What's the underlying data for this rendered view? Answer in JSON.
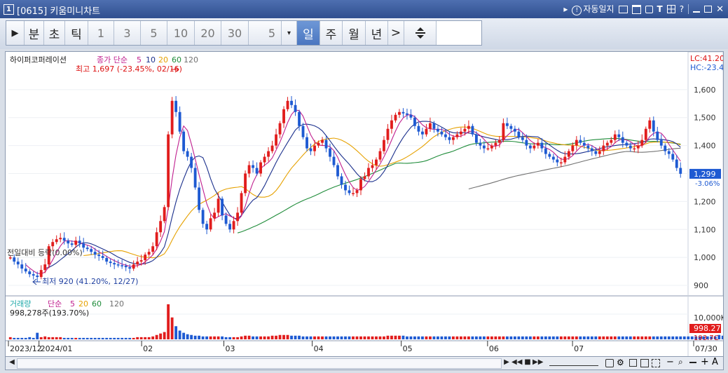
{
  "window": {
    "number_badge": "1",
    "title": "[0615] 키움미니차트",
    "title_right": {
      "arrow": "▸",
      "indicator_label": "자동일지",
      "icons": [
        "layout-icon",
        "window-icon",
        "pin-icon",
        "text-icon",
        "grid-icon",
        "help-icon"
      ],
      "help_label": "?",
      "text_label": "T"
    }
  },
  "toolbar": {
    "play_label": "▶",
    "period_units": [
      "분",
      "초",
      "틱"
    ],
    "intervals": [
      "1",
      "3",
      "5",
      "10",
      "20",
      "30"
    ],
    "custom_interval": "5",
    "dropdown_label": "▾",
    "periods": [
      "일",
      "주",
      "월",
      "년"
    ],
    "selected_period": "일",
    "next_label": ">",
    "tool_icon": "split-vertical-icon"
  },
  "price_panel": {
    "stock_name": "하이퍼코퍼레이션",
    "ma_label": "종가 단순",
    "ma_periods": [
      "5",
      "10",
      "20",
      "60",
      "120"
    ],
    "ma_colors": [
      "#c0208f",
      "#1a2f8c",
      "#e6a100",
      "#1f8c3a",
      "#707070"
    ],
    "max_annotation": "최고 1,697 (-23.45%, 02/16)",
    "min_annotation": "최저 920 (41.20%, 12/27)",
    "prev_close_annotation": "전일대비 등락(0.00%)",
    "lc_label": "LC:41.20",
    "hc_label": "HC:-23.4",
    "current_price": "1,299",
    "current_change": "-3.06%",
    "y_ticks": [
      "1,600",
      "1,500",
      "1,400",
      "1,300",
      "1,200",
      "1,100",
      "1,000",
      "900"
    ]
  },
  "volume_panel": {
    "label": "거래량",
    "ma_label": "단순",
    "ma_periods": [
      "5",
      "20",
      "60",
      "120"
    ],
    "value_text": "998,278주(193.70%)",
    "y_tick": "10,000K",
    "current_volume": "998.27",
    "current_ratio": "193.7C"
  },
  "x_axis": {
    "labels": [
      "2023/12",
      "2024/01",
      "02",
      "03",
      "04",
      "05",
      "06",
      "07",
      "07/30"
    ]
  },
  "chart_data": {
    "type": "candlestick",
    "x_start": "2023/12",
    "x_end": "07/30",
    "ylim": [
      870,
      1720
    ],
    "max": {
      "value": 1697,
      "date": "02/16"
    },
    "min": {
      "value": 920,
      "date": "12/27"
    },
    "last_close": 1299,
    "close_path": [
      1000,
      985,
      975,
      960,
      950,
      940,
      935,
      930,
      955,
      975,
      1040,
      1055,
      1065,
      1070,
      1060,
      1050,
      1045,
      1060,
      1050,
      1035,
      1030,
      1020,
      1010,
      1005,
      998,
      985,
      980,
      975,
      972,
      970,
      965,
      960,
      975,
      985,
      990,
      1010,
      1020,
      1040,
      1090,
      1130,
      1180,
      1440,
      1560,
      1520,
      1450,
      1380,
      1360,
      1320,
      1250,
      1170,
      1120,
      1100,
      1140,
      1160,
      1210,
      1150,
      1120,
      1100,
      1130,
      1160,
      1230,
      1300,
      1330,
      1320,
      1300,
      1340,
      1360,
      1380,
      1400,
      1440,
      1480,
      1530,
      1560,
      1545,
      1520,
      1470,
      1430,
      1390,
      1380,
      1400,
      1410,
      1420,
      1390,
      1360,
      1330,
      1290,
      1260,
      1240,
      1230,
      1230,
      1240,
      1280,
      1290,
      1320,
      1330,
      1350,
      1380,
      1420,
      1460,
      1490,
      1510,
      1520,
      1515,
      1510,
      1500,
      1470,
      1450,
      1440,
      1460,
      1480,
      1460,
      1450,
      1440,
      1430,
      1420,
      1430,
      1440,
      1450,
      1460,
      1470,
      1440,
      1410,
      1400,
      1390,
      1390,
      1400,
      1410,
      1420,
      1480,
      1470,
      1460,
      1450,
      1430,
      1420,
      1400,
      1390,
      1400,
      1410,
      1390,
      1370,
      1360,
      1350,
      1340,
      1340,
      1360,
      1380,
      1400,
      1420,
      1410,
      1400,
      1390,
      1380,
      1370,
      1380,
      1400,
      1410,
      1420,
      1440,
      1430,
      1410,
      1400,
      1390,
      1390,
      1400,
      1420,
      1460,
      1490,
      1450,
      1420,
      1400,
      1380,
      1370,
      1350,
      1320,
      1299
    ],
    "volume_path": [
      3,
      2,
      2,
      2,
      2,
      3,
      2,
      9,
      3,
      4,
      3,
      3,
      3,
      3,
      2,
      2,
      2,
      2,
      2,
      2,
      2,
      2,
      2,
      2,
      2,
      2,
      2,
      2,
      2,
      2,
      2,
      2,
      2,
      3,
      3,
      3,
      3,
      4,
      6,
      8,
      10,
      48,
      30,
      18,
      12,
      9,
      7,
      6,
      5,
      5,
      4,
      4,
      4,
      4,
      4,
      4,
      3,
      3,
      3,
      3,
      4,
      5,
      5,
      4,
      4,
      4,
      4,
      4,
      5,
      5,
      6,
      6,
      6,
      5,
      5,
      5,
      4,
      4,
      4,
      4,
      4,
      4,
      4,
      4,
      4,
      4,
      4,
      4,
      4,
      4,
      4,
      4,
      4,
      4,
      4,
      4,
      4,
      4,
      5,
      5,
      5,
      5,
      5,
      4,
      4,
      4,
      4,
      4,
      4,
      4,
      4,
      4,
      4,
      4,
      4,
      4,
      4,
      4,
      4,
      4,
      4,
      4,
      4,
      4,
      4,
      4,
      4,
      4,
      4,
      4,
      4,
      4,
      4,
      4,
      4,
      4,
      4,
      4,
      4,
      4,
      4,
      4,
      4,
      4,
      4,
      4,
      4,
      4,
      4,
      4,
      4,
      4,
      4,
      4,
      4,
      4,
      4,
      4,
      4,
      4,
      4,
      4,
      4,
      4,
      4,
      4,
      4,
      4,
      4,
      4,
      4,
      4,
      4,
      4,
      4,
      4,
      4,
      4,
      4,
      4,
      4,
      4,
      4,
      4,
      6,
      5,
      4,
      4,
      5,
      6,
      9
    ]
  },
  "scroll": {
    "controls": [
      "◀",
      "▶",
      "◀◀",
      "■",
      "▶▶"
    ],
    "right_icons": [
      "zoom-slider-icon",
      "chart-settings-icon",
      "gear-icon",
      "copy-icon",
      "grid-icon",
      "minus-icon",
      "search-icon",
      "zoom-minus-icon",
      "zoom-plus-icon",
      "font-size-icon"
    ],
    "minus_label": "−",
    "plus_label": "+",
    "font_label": "A"
  }
}
